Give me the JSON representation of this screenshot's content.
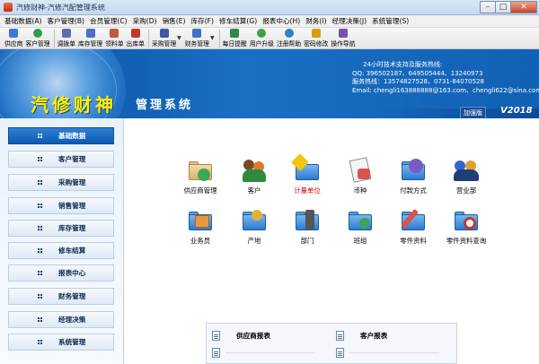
{
  "window": {
    "title": "汽修财神-汽修汽配管理系统",
    "controls": {
      "minimize": "–",
      "maximize": "□",
      "close": "✕"
    }
  },
  "menu": [
    "基础数据(A)",
    "客户管理(B)",
    "会员管理(C)",
    "采购(D)",
    "销售(E)",
    "库存(F)",
    "修车结算(G)",
    "报表中心(H)",
    "财务(I)",
    "经理决策(J)",
    "系统管理(S)"
  ],
  "toolbar": {
    "items": [
      {
        "label": "供应商",
        "icon": "supplier-icon",
        "color": "#3a7bd5"
      },
      {
        "label": "客户管理",
        "icon": "customer-icon",
        "color": "#2e9b4a"
      },
      {
        "label": "调拨单",
        "icon": "transfer-icon",
        "color": "#5b6fb0"
      },
      {
        "label": "库存管理",
        "icon": "inventory-icon",
        "color": "#4a6fc0"
      },
      {
        "label": "领料单",
        "icon": "pick-icon",
        "color": "#c05a3a"
      },
      {
        "label": "出库单",
        "icon": "outbound-icon",
        "color": "#c0392b"
      },
      {
        "label": "采购管理",
        "icon": "purchase-icon",
        "color": "#3a5aa8"
      },
      {
        "label": "财务管理",
        "icon": "finance-icon",
        "color": "#3d72c4"
      },
      {
        "label": "每日提醒",
        "icon": "reminder-icon",
        "color": "#2f8a4a"
      },
      {
        "label": "用户升级",
        "icon": "upgrade-icon",
        "color": "#3fa04a"
      },
      {
        "label": "注册帮助",
        "icon": "help-icon",
        "color": "#2f7fc9"
      },
      {
        "label": "密码修改",
        "icon": "key-icon",
        "color": "#d4a017"
      },
      {
        "label": "操作导航",
        "icon": "navigate-icon",
        "color": "#7a4fb0"
      }
    ]
  },
  "banner": {
    "title": "汽修财神",
    "subtitle": "管理系统",
    "contact_header": "24小时技术支持及服务热线:",
    "qq": "QQ: 396502187、649505444、13240973",
    "phone": "服务热线：13574827528、0731-84070528",
    "email": "Email: chengli163888888@163.com、chengli622@sina.com",
    "edition": "加强版",
    "version": "V2018"
  },
  "sidebar": {
    "items": [
      {
        "label": "基础数据",
        "active": true
      },
      {
        "label": "客户管理",
        "active": false
      },
      {
        "label": "采购管理",
        "active": false
      },
      {
        "label": "销售管理",
        "active": false
      },
      {
        "label": "库存管理",
        "active": false
      },
      {
        "label": "修车结算",
        "active": false
      },
      {
        "label": "报表中心",
        "active": false
      },
      {
        "label": "财务管理",
        "active": false
      },
      {
        "label": "经理决策",
        "active": false
      },
      {
        "label": "系统管理",
        "active": false
      }
    ]
  },
  "main": {
    "icons": [
      {
        "label": "供应商管理",
        "icon": "supplier-icon",
        "accent": "#3aa856",
        "highlight": false
      },
      {
        "label": "客户",
        "icon": "customer-icon",
        "accent": "#e07a2b",
        "highlight": false
      },
      {
        "label": "计量单位",
        "icon": "unit-icon",
        "accent": "#f2c511",
        "highlight": true
      },
      {
        "label": "币种",
        "icon": "currency-icon",
        "accent": "#d9534f",
        "highlight": false
      },
      {
        "label": "付款方式",
        "icon": "payment-icon",
        "accent": "#7a5bc4",
        "highlight": false
      },
      {
        "label": "营业部",
        "icon": "branch-icon",
        "accent": "#3366cc",
        "highlight": false
      },
      {
        "label": "业务员",
        "icon": "salesman-icon",
        "accent": "#e89b3a",
        "highlight": false
      },
      {
        "label": "产地",
        "icon": "origin-icon",
        "accent": "#e2b13c",
        "highlight": false
      },
      {
        "label": "部门",
        "icon": "department-icon",
        "accent": "#555555",
        "highlight": false
      },
      {
        "label": "班组",
        "icon": "team-icon",
        "accent": "#3ba55c",
        "highlight": false
      },
      {
        "label": "零件资料",
        "icon": "parts-icon",
        "accent": "#d9534f",
        "highlight": false
      },
      {
        "label": "零件资料查询",
        "icon": "parts-search-icon",
        "accent": "#c0392b",
        "highlight": false
      }
    ],
    "reports": {
      "left_title": "供应商报表",
      "right_title": "客户报表"
    }
  },
  "colors": {
    "banner": "#1161b4",
    "title_yellow": "#fff200",
    "sidebar_active": "#0d5bb2",
    "highlight_red": "#d40000"
  }
}
